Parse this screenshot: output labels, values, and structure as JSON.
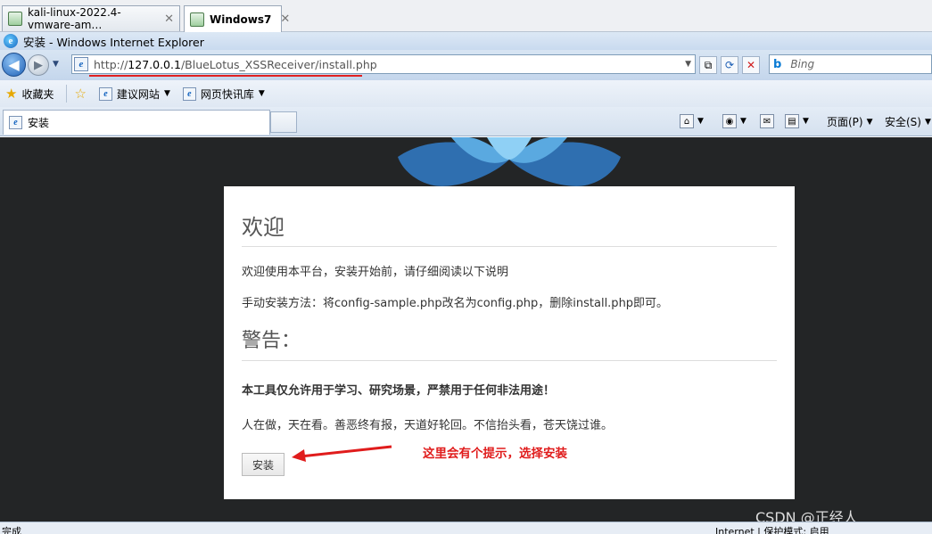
{
  "vm_tabs": [
    {
      "label": "kali-linux-2022.4-vmware-am…"
    },
    {
      "label": "Windows7"
    }
  ],
  "window_title": "安装 - Windows Internet Explorer",
  "address": {
    "scheme": "http://",
    "host": "127.0.0.1",
    "path": "/BlueLotus_XSSReceiver/install.php"
  },
  "search": {
    "placeholder": "Bing"
  },
  "favorites": {
    "fav_label": "收藏夹",
    "items": [
      {
        "label": "建议网站"
      },
      {
        "label": "网页快讯库"
      }
    ]
  },
  "tab": {
    "label": "安装"
  },
  "commands": {
    "page": "页面(P)",
    "safety": "安全(S)"
  },
  "content": {
    "welcome_heading": "欢迎",
    "intro": "欢迎使用本平台，安装开始前，请仔细阅读以下说明",
    "manual": "手动安装方法：将config-sample.php改名为config.php，删除install.php即可。",
    "warning_heading": "警告：",
    "warning_bold": "本工具仅允许用于学习、研究场景，严禁用于任何非法用途！",
    "motto": "人在做，天在看。善恶终有报，天道好轮回。不信抬头看，苍天饶过谁。",
    "install_button": "安装"
  },
  "annotation": "这里会有个提示，选择安装",
  "status": {
    "left": "完成",
    "right": "Internet | 保护模式: 启用"
  },
  "watermark": "CSDN @正经人_"
}
